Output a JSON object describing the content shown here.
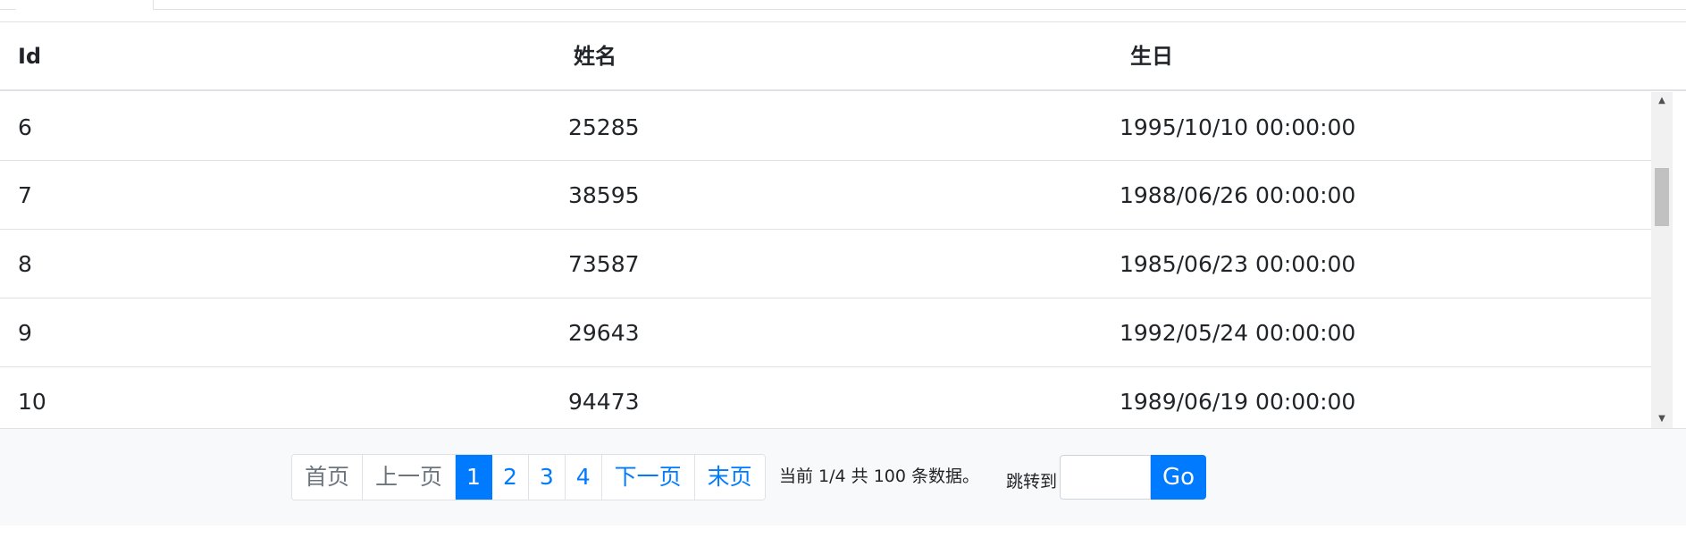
{
  "table": {
    "columns": [
      "Id",
      "姓名",
      "生日"
    ],
    "rows": [
      {
        "id": "6",
        "name": "25285",
        "birthday": "1995/10/10 00:00:00"
      },
      {
        "id": "7",
        "name": "38595",
        "birthday": "1988/06/26 00:00:00"
      },
      {
        "id": "8",
        "name": "73587",
        "birthday": "1985/06/23 00:00:00"
      },
      {
        "id": "9",
        "name": "29643",
        "birthday": "1992/05/24 00:00:00"
      },
      {
        "id": "10",
        "name": "94473",
        "birthday": "1989/06/19 00:00:00"
      }
    ]
  },
  "scrollbar": {
    "up_icon": "triangle-up-icon",
    "down_icon": "triangle-down-icon"
  },
  "pager": {
    "first": "首页",
    "prev": "上一页",
    "pages": [
      "1",
      "2",
      "3",
      "4"
    ],
    "active_page": "1",
    "next": "下一页",
    "last": "末页"
  },
  "status": "当前 1/4 共 100 条数据。",
  "jump": {
    "label": "跳转到",
    "value": "",
    "button": "Go"
  },
  "colors": {
    "primary": "#007bff",
    "border": "#dee2e6",
    "footer_bg": "#f8f9fa",
    "muted": "#6c757d"
  }
}
